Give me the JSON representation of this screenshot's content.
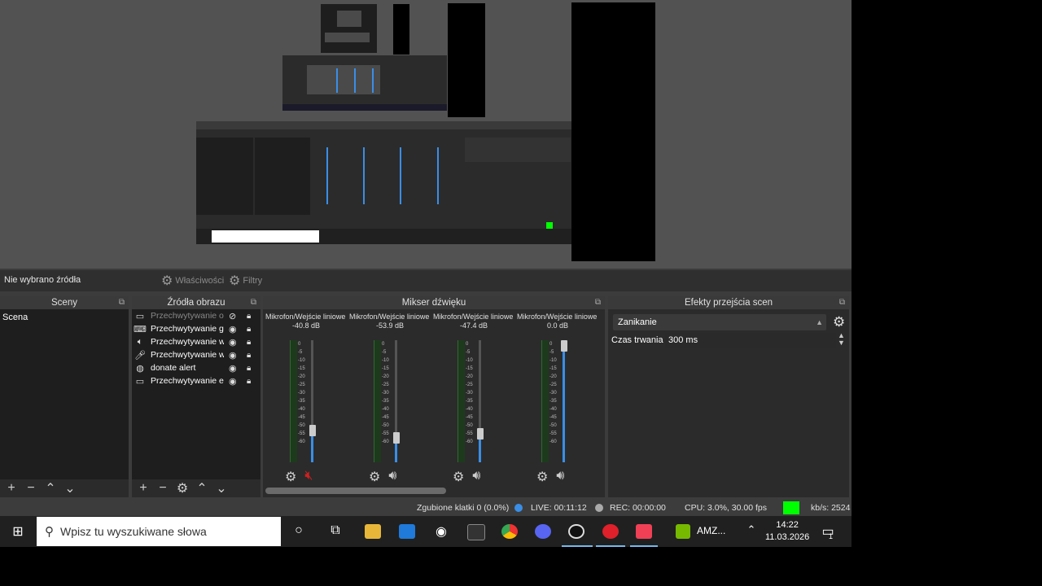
{
  "source_toolbar": {
    "no_source": "Nie wybrano źródła",
    "properties": "Właściwości",
    "filters": "Filtry"
  },
  "scenes": {
    "title": "Sceny",
    "items": [
      "Scena"
    ]
  },
  "sources": {
    "title": "Źródła obrazu",
    "items": [
      {
        "name": "Przechwytywanie o",
        "icon": "window-icon",
        "hidden": true
      },
      {
        "name": "Przechwytywanie g",
        "icon": "gamepad-icon",
        "hidden": false
      },
      {
        "name": "Przechwytywanie w",
        "icon": "speaker-icon",
        "hidden": false
      },
      {
        "name": "Przechwytywanie w",
        "icon": "microphone-icon",
        "hidden": false
      },
      {
        "name": "donate alert",
        "icon": "globe-icon",
        "hidden": false
      },
      {
        "name": "Przechwytywanie e",
        "icon": "monitor-icon",
        "hidden": false
      }
    ]
  },
  "mixer": {
    "title": "Mikser dźwięku",
    "channels": [
      {
        "name": "Mikrofon/Wejście liniowe",
        "db": "-40.8 dB",
        "volume": 0.26,
        "muted": true
      },
      {
        "name": "Mikrofon/Wejście liniowe",
        "db": "-53.9 dB",
        "volume": 0.2,
        "muted": false
      },
      {
        "name": "Mikrofon/Wejście liniowe",
        "db": "-47.4 dB",
        "volume": 0.23,
        "muted": false
      },
      {
        "name": "Mikrofon/Wejście liniowe",
        "db": "0.0 dB",
        "volume": 1.0,
        "muted": false
      }
    ],
    "ticks": [
      "0",
      "-5",
      "-10",
      "-15",
      "-20",
      "-25",
      "-30",
      "-35",
      "-40",
      "-45",
      "-50",
      "-55",
      "-60"
    ]
  },
  "transitions": {
    "title": "Efekty przejścia scen",
    "selected": "Zanikanie",
    "duration_label": "Czas trwania",
    "duration_value": "300 ms"
  },
  "status": {
    "dropped": "Zgubione klatki 0 (0.0%)",
    "live": "LIVE: 00:11:12",
    "rec": "REC: 00:00:00",
    "cpu": "CPU: 3.0%, 30.00 fps",
    "kbs": "kb/s: 2524",
    "live_color": "#3a8ee6",
    "health_color": "#00ff00"
  },
  "taskbar": {
    "search_placeholder": "Wpisz tu wyszukiwane słowa",
    "apps": [
      "cortana-icon",
      "task-view-icon",
      "file-explorer-icon",
      "mail-icon",
      "steam-icon",
      "epic-games-icon",
      "chrome-icon",
      "discord-icon",
      "obs-icon",
      "app-red-icon",
      "pocket-icon",
      "nvidia-icon"
    ],
    "nvidia_label": "AMZ...",
    "time": "14:22",
    "date": "11.03.2026",
    "notifications": "1"
  }
}
